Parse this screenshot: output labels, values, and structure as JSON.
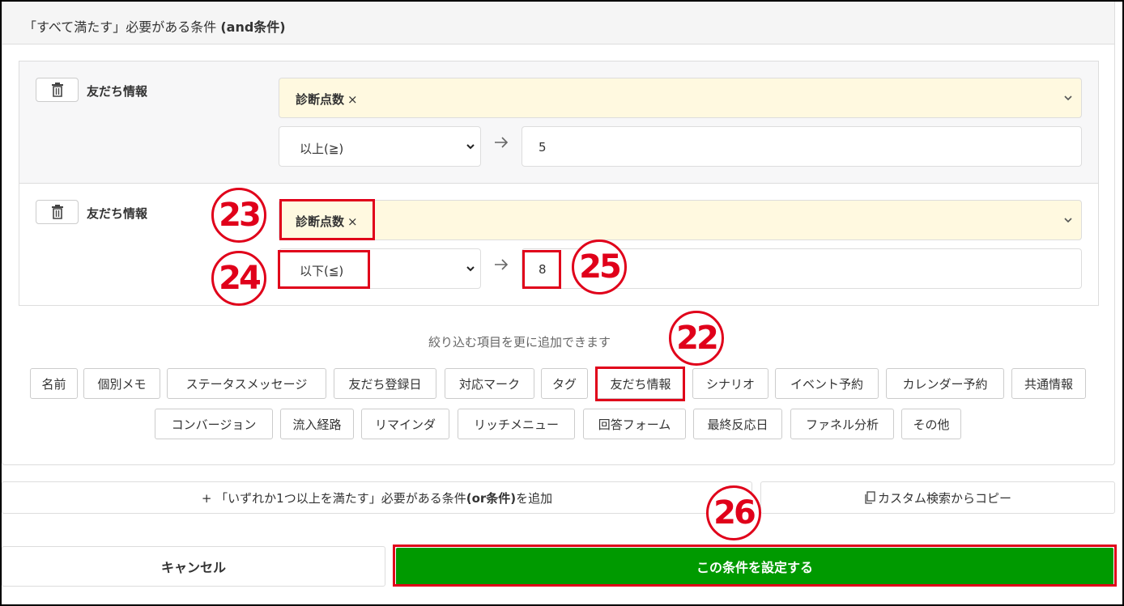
{
  "panel": {
    "title_prefix": "「すべて満たす」必要がある条件 ",
    "title_bold": "(and条件)"
  },
  "conditions": [
    {
      "label": "友だち情報",
      "tag": "診断点数",
      "tag_remove": "×",
      "operator": "以上(≧)",
      "value": "5"
    },
    {
      "label": "友だち情報",
      "tag": "診断点数",
      "tag_remove": "×",
      "operator": "以下(≦)",
      "value": "8"
    }
  ],
  "hint": "絞り込む項目を更に追加できます",
  "chips_row1": [
    "名前",
    "個別メモ",
    "ステータスメッセージ",
    "友だち登録日",
    "対応マーク",
    "タグ",
    "友だち情報",
    "シナリオ",
    "イベント予約",
    "カレンダー予約",
    "共通情報"
  ],
  "chips_row2": [
    "コンバージョン",
    "流入経路",
    "リマインダ",
    "リッチメニュー",
    "回答フォーム",
    "最終反応日",
    "ファネル分析",
    "その他"
  ],
  "or_button": {
    "prefix": "+ 「いずれか1つ以上を満たす」必要がある条件",
    "bold": "(or条件)",
    "suffix": "を追加"
  },
  "copy_button": "カスタム検索からコピー",
  "cancel_button": "キャンセル",
  "submit_button": "この条件を設定する",
  "annotations": {
    "b22": "22",
    "b23": "23",
    "b24": "24",
    "b25": "25",
    "b26": "26"
  },
  "icons": {
    "delete": "trash-icon",
    "dropdown": "chevron-down-icon",
    "arrow": "arrow-right-icon",
    "copy": "copy-icon"
  },
  "colors": {
    "highlight": "#e0001a",
    "submit_bg": "#009a00",
    "tag_bg": "#fff9e0"
  }
}
